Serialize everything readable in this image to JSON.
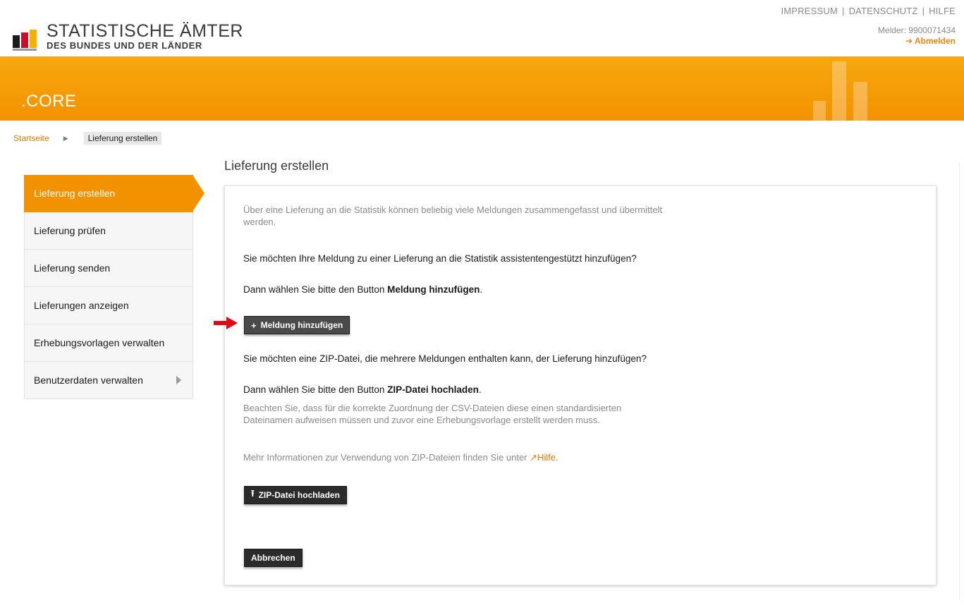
{
  "header": {
    "links": [
      "IMPRESSUM",
      "DATENSCHUTZ",
      "HILFE"
    ],
    "separator": "|",
    "user_label": "Melder: 9900071434",
    "logout": "➔ Abmelden",
    "logo_title": "STATISTISCHE ÄMTER",
    "logo_subtitle": "DES BUNDES UND DER LÄNDER",
    "logo_colors": [
      "#1a1a1a",
      "#c8102e",
      "#f3b200"
    ]
  },
  "banner": {
    "title": ".CORE",
    "color": "#f39200"
  },
  "breadcrumb": {
    "home": "Startseite",
    "separator": "▶",
    "current": "Lieferung erstellen"
  },
  "sidebar": {
    "items": [
      {
        "label": "Lieferung erstellen",
        "active": true
      },
      {
        "label": "Lieferung prüfen"
      },
      {
        "label": "Lieferung senden"
      },
      {
        "label": "Lieferungen anzeigen"
      },
      {
        "label": "Erhebungsvorlagen verwalten"
      },
      {
        "label": "Benutzerdaten verwalten",
        "has_submenu": true
      }
    ]
  },
  "main": {
    "title": "Lieferung erstellen",
    "intro": "Über eine Lieferung an die Statistik können beliebig viele Meldungen zusammengefasst und übermittelt werden.",
    "question1": "Sie möchten Ihre Meldung zu einer Lieferung an die Statistik assistentengestützt hinzufügen?",
    "instruction1_prefix": "Dann wählen Sie bitte den Button ",
    "instruction1_bold": "Meldung hinzufügen",
    "instruction1_suffix": ".",
    "add_button": {
      "icon": "plus-icon",
      "glyph": "+",
      "label": "Meldung hinzufügen"
    },
    "question2": "Sie möchten eine ZIP-Datei, die mehrere Meldungen enthalten kann, der Lieferung hinzufügen?",
    "instruction2_prefix": "Dann wählen Sie bitte den Button ",
    "instruction2_bold": "ZIP-Datei hochladen",
    "instruction2_suffix": ".",
    "note": "Beachten Sie, dass für die korrekte Zuordnung der CSV-Dateien diese einen standardisierten Dateinamen aufweisen müssen und zuvor eine Erhebungsvorlage erstellt werden muss.",
    "more_info_prefix": "Mehr Informationen zur Verwendung von ZIP-Dateien finden Sie unter ",
    "help_link": "Hilfe",
    "help_link_icon": "external-link-icon",
    "help_link_glyph": "↗",
    "more_info_suffix": ".",
    "upload_button": {
      "icon": "upload-icon",
      "glyph": "⭱",
      "label": "ZIP-Datei hochladen"
    },
    "cancel_button": {
      "label": "Abbrechen"
    }
  },
  "annotation": {
    "icon": "red-arrow-icon",
    "color": "#e30613"
  }
}
